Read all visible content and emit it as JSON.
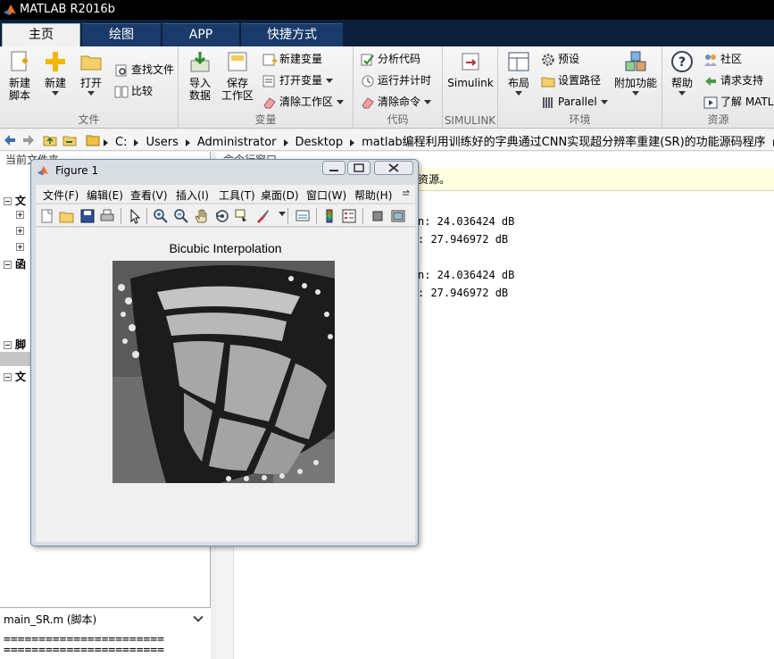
{
  "app": {
    "title": "MATLAB R2016b"
  },
  "tabs": [
    {
      "label": "主页",
      "active": true
    },
    {
      "label": "绘图"
    },
    {
      "label": "APP"
    },
    {
      "label": "快捷方式"
    }
  ],
  "ribbon": {
    "file": {
      "label": "文件",
      "new_script": "新建\n脚本",
      "new": "新建",
      "open": "打开",
      "find_files": "查找文件",
      "compare": "比较"
    },
    "variable": {
      "label": "变量",
      "import": "导入\n数据",
      "save_ws": "保存\n工作区",
      "new_var": "新建变量",
      "open_var": "打开变量",
      "clear_ws": "清除工作区"
    },
    "code": {
      "label": "代码",
      "analyze": "分析代码",
      "run_time": "运行并计时",
      "clear_cmd": "清除命令"
    },
    "simulink": {
      "label": "SIMULINK",
      "btn": "Simulink"
    },
    "environment": {
      "label": "环境",
      "layout": "布局",
      "prefs": "预设",
      "set_path": "设置路径",
      "parallel": "Parallel",
      "addons": "附加功能"
    },
    "resources": {
      "label": "资源",
      "help": "帮助",
      "community": "社区",
      "support": "请求支持",
      "learn": "了解 MATL"
    }
  },
  "address": {
    "crumbs": [
      "C:",
      "Users",
      "Administrator",
      "Desktop",
      "matlab编程利用训练好的字典通过CNN实现超分辨率重建(SR)的功能源码程序",
      "code"
    ]
  },
  "left_panel": {
    "title": "当前文件夹",
    "sections": [
      "文",
      "函",
      "脚",
      "文"
    ],
    "detail_title": "main_SR.m (脚本)",
    "detail_code": "=======================\n======================="
  },
  "command_window": {
    "title": "命令行窗口",
    "notice": "资源。",
    "lines": [
      "n: 24.036424 dB",
      ": 27.946972 dB",
      "n: 24.036424 dB",
      ": 27.946972 dB"
    ]
  },
  "figure": {
    "title": "Figure 1",
    "menus": [
      "文件(F)",
      "编辑(E)",
      "查看(V)",
      "插入(I)",
      "工具(T)",
      "桌面(D)",
      "窗口(W)",
      "帮助(H)"
    ],
    "axes_title": "Bicubic Interpolation"
  }
}
